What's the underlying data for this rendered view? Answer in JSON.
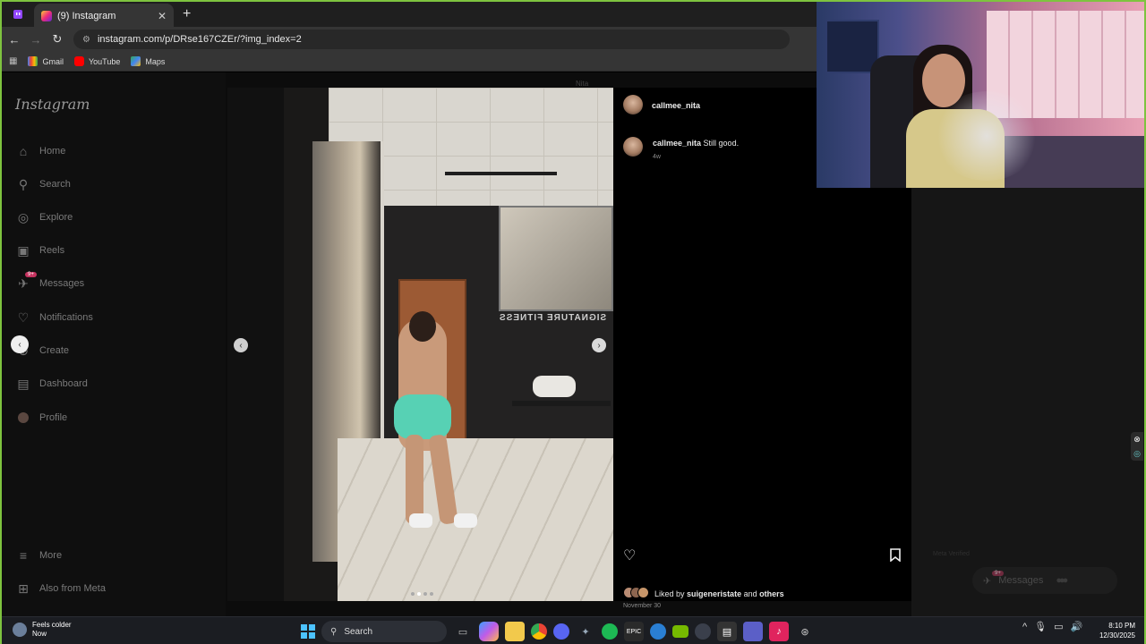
{
  "browser": {
    "tab_title": "(9) Instagram",
    "url": "instagram.com/p/DRse167CZEr/?img_index=2",
    "bookmarks": [
      "Gmail",
      "YouTube",
      "Maps"
    ]
  },
  "instagram": {
    "logo": "Instagram",
    "nav": [
      {
        "label": "Home",
        "icon": "home-icon"
      },
      {
        "label": "Search",
        "icon": "search-icon"
      },
      {
        "label": "Explore",
        "icon": "compass-icon"
      },
      {
        "label": "Reels",
        "icon": "reels-icon"
      },
      {
        "label": "Messages",
        "icon": "messenger-icon",
        "badge": "9+"
      },
      {
        "label": "Notifications",
        "icon": "heart-icon"
      },
      {
        "label": "Create",
        "icon": "plus-icon"
      },
      {
        "label": "Dashboard",
        "icon": "dashboard-icon"
      },
      {
        "label": "Profile",
        "icon": "avatar-icon"
      }
    ],
    "bottom_nav": [
      {
        "label": "More",
        "icon": "menu-icon"
      },
      {
        "label": "Also from Meta",
        "icon": "meta-icon"
      }
    ],
    "post": {
      "username": "callmee_nita",
      "comment_user": "callmee_nita",
      "comment_text": "Still good.",
      "comment_age": "4w",
      "liked_prefix": "Liked by",
      "liked_user": "suigeneristate",
      "liked_and": "and",
      "liked_others": "others",
      "date": "November 30",
      "photo_watermark": "Nita",
      "photo_sign": "SIGNATURE FITNESS"
    },
    "messages_pill": {
      "label": "Messages",
      "badge": "9+"
    },
    "faint_text": "Meta Verified"
  },
  "taskbar": {
    "weather_title": "Feels colder",
    "weather_sub": "Now",
    "search_label": "Search",
    "time": "8:10 PM",
    "date": "12/30/2025"
  },
  "colors": {
    "instagram_gradient": [
      "#f9ce34",
      "#ee2a7b",
      "#6228d7"
    ],
    "notification_badge": "#c5325f",
    "browser_frame": "#7ec33f"
  }
}
